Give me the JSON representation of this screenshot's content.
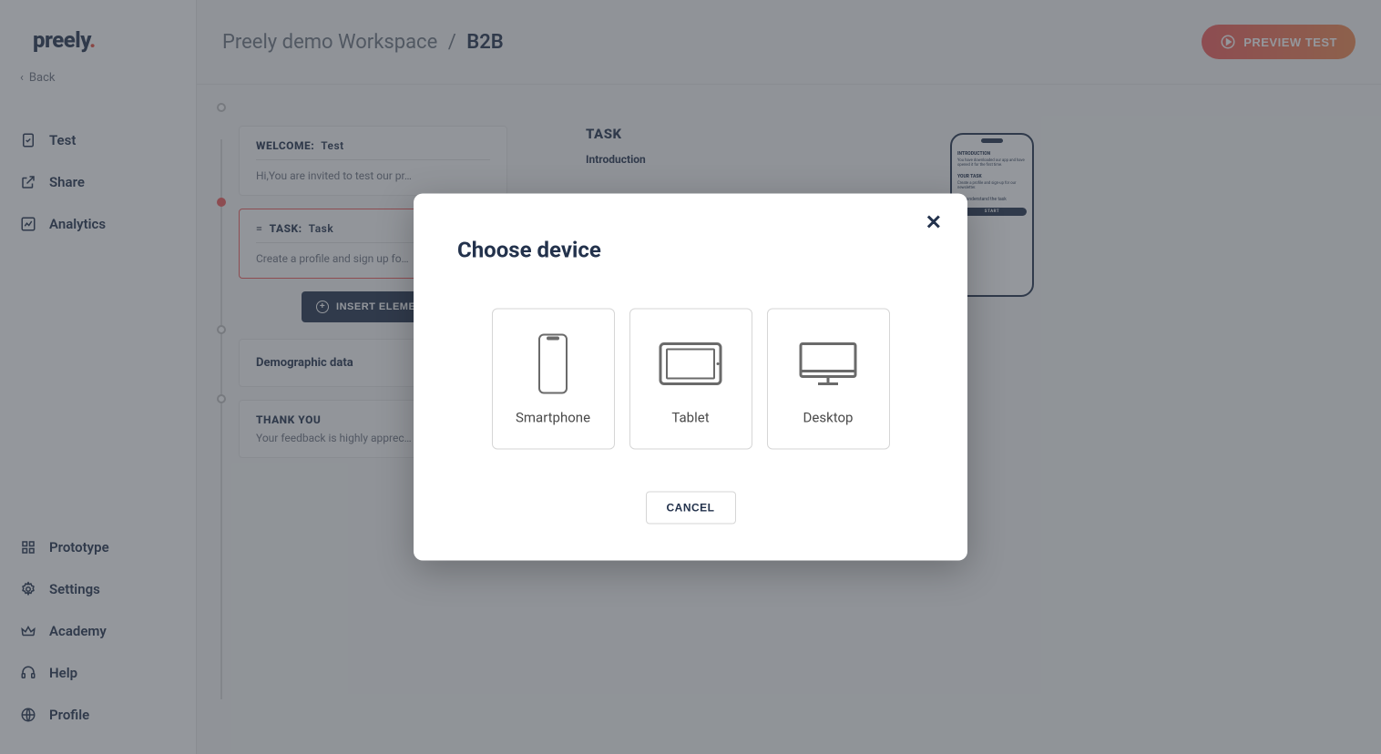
{
  "brand": {
    "name": "preely"
  },
  "back_label": "Back",
  "sidebar": {
    "top": [
      {
        "label": "Test",
        "icon": "file-check-icon"
      },
      {
        "label": "Share",
        "icon": "share-icon"
      },
      {
        "label": "Analytics",
        "icon": "analytics-icon"
      }
    ],
    "bottom": [
      {
        "label": "Prototype",
        "icon": "grid-icon"
      },
      {
        "label": "Settings",
        "icon": "gear-icon"
      },
      {
        "label": "Academy",
        "icon": "crown-icon"
      },
      {
        "label": "Help",
        "icon": "headset-icon"
      },
      {
        "label": "Profile",
        "icon": "globe-icon"
      }
    ]
  },
  "breadcrumb": {
    "workspace": "Preely demo Workspace",
    "current": "B2B",
    "separator": "/"
  },
  "preview_label": "PREVIEW TEST",
  "flow": {
    "welcome": {
      "head": "WELCOME:",
      "title": "Test",
      "body": "Hi,You are invited to test our pr…"
    },
    "task": {
      "head": "TASK:",
      "title": "Task",
      "body": "Create a profile and sign up fo…"
    },
    "insert_label": "INSERT ELEMENT",
    "demographic": {
      "head": "Demographic data"
    },
    "thankyou": {
      "head": "THANK YOU",
      "body": "Your feedback is highly apprec…"
    }
  },
  "right": {
    "title": "TASK",
    "subtitle": "Introduction"
  },
  "phone": {
    "intro_head": "INTRODUCTION",
    "intro_body": "You have downloaded our app and have opened it for the first time.",
    "task_head": "YOUR TASK",
    "task_body": "Create a profile and sign-up for our newsletter.",
    "checkbox_label": "I understand the task",
    "start_label": "START"
  },
  "modal": {
    "title": "Choose device",
    "devices": [
      {
        "label": "Smartphone"
      },
      {
        "label": "Tablet"
      },
      {
        "label": "Desktop"
      }
    ],
    "cancel_label": "CANCEL"
  }
}
